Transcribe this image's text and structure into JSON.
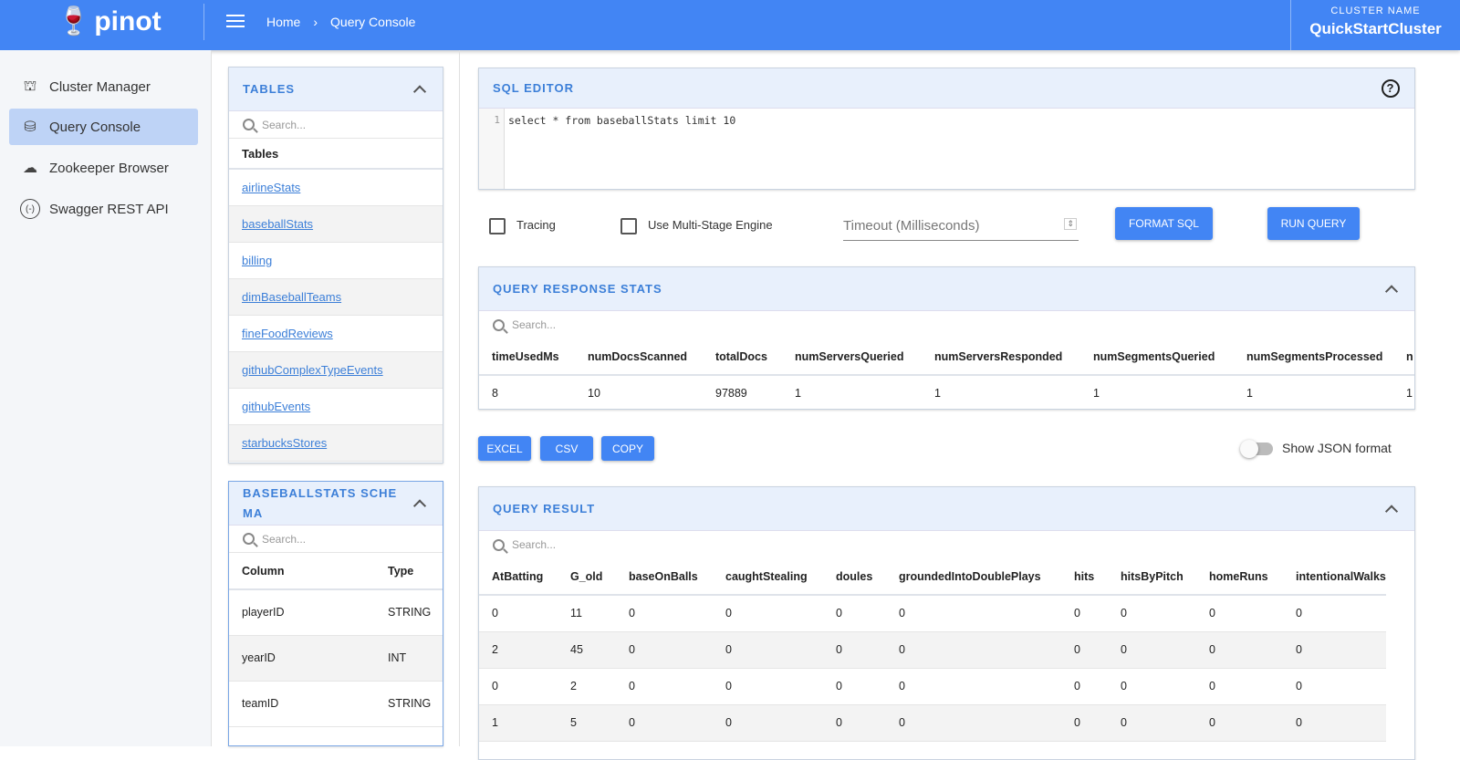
{
  "header": {
    "logo": "pinot",
    "breadcrumb": [
      "Home",
      "Query Console"
    ],
    "cluster_label": "CLUSTER NAME",
    "cluster_name": "QuickStartCluster"
  },
  "sidebar": {
    "items": [
      {
        "label": "Cluster Manager",
        "icon": "sitemap-icon"
      },
      {
        "label": "Query Console",
        "icon": "database-search-icon",
        "active": true
      },
      {
        "label": "Zookeeper Browser",
        "icon": "zookeeper-icon"
      },
      {
        "label": "Swagger REST API",
        "icon": "api-icon"
      }
    ]
  },
  "tables_panel": {
    "title": "TABLES",
    "search_placeholder": "Search...",
    "header": "Tables",
    "items": [
      "airlineStats",
      "baseballStats",
      "billing",
      "dimBaseballTeams",
      "fineFoodReviews",
      "githubComplexTypeEvents",
      "githubEvents",
      "starbucksStores"
    ]
  },
  "schema_panel": {
    "title": "BASEBALLSTATS SCHEMA",
    "search_placeholder": "Search...",
    "columns": [
      "Column",
      "Type"
    ],
    "rows": [
      [
        "playerID",
        "STRING"
      ],
      [
        "yearID",
        "INT"
      ],
      [
        "teamID",
        "STRING"
      ]
    ]
  },
  "sql_editor": {
    "title": "SQL EDITOR",
    "line": "1",
    "query": "select * from baseballStats limit 10"
  },
  "options": {
    "tracing": "Tracing",
    "multistage": "Use Multi-Stage Engine",
    "timeout_placeholder": "Timeout (Milliseconds)",
    "format_sql": "FORMAT SQL",
    "run_query": "RUN QUERY"
  },
  "stats": {
    "title": "QUERY RESPONSE STATS",
    "search_placeholder": "Search...",
    "columns": [
      "timeUsedMs",
      "numDocsScanned",
      "totalDocs",
      "numServersQueried",
      "numServersResponded",
      "numSegmentsQueried",
      "numSegmentsProcessed",
      "n"
    ],
    "values": [
      "8",
      "10",
      "97889",
      "1",
      "1",
      "1",
      "1",
      "1"
    ]
  },
  "export": {
    "excel": "EXCEL",
    "csv": "CSV",
    "copy": "COPY",
    "json_toggle": "Show JSON format",
    "json_on": false
  },
  "result": {
    "title": "QUERY RESULT",
    "search_placeholder": "Search...",
    "columns": [
      "AtBatting",
      "G_old",
      "baseOnBalls",
      "caughtStealing",
      "doules",
      "groundedIntoDoublePlays",
      "hits",
      "hitsByPitch",
      "homeRuns",
      "intentionalWalks"
    ],
    "rows": [
      [
        "0",
        "11",
        "0",
        "0",
        "0",
        "0",
        "0",
        "0",
        "0",
        "0"
      ],
      [
        "2",
        "45",
        "0",
        "0",
        "0",
        "0",
        "0",
        "0",
        "0",
        "0"
      ],
      [
        "0",
        "2",
        "0",
        "0",
        "0",
        "0",
        "0",
        "0",
        "0",
        "0"
      ],
      [
        "1",
        "5",
        "0",
        "0",
        "0",
        "0",
        "0",
        "0",
        "0",
        "0"
      ]
    ]
  },
  "colors": {
    "primary": "#4285f4",
    "panel_header": "#e8f0fc",
    "active_nav": "#bed3f6"
  }
}
